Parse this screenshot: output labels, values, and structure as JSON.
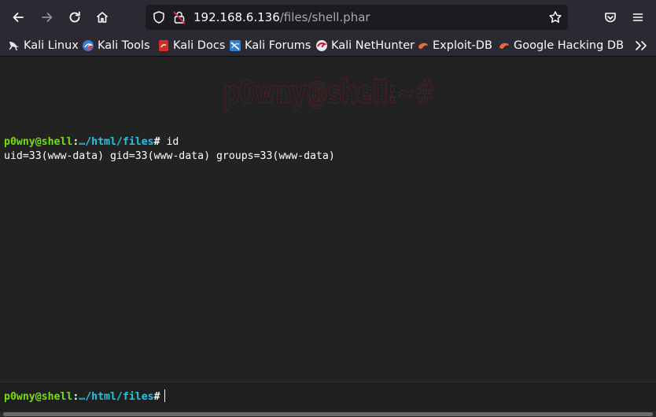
{
  "browser": {
    "url_host": "192.168.6.136",
    "url_path": "/files/shell.phar"
  },
  "bookmarks": [
    {
      "label": "Kali Linux",
      "icon": "kali-dragon-icon"
    },
    {
      "label": "Kali Tools",
      "icon": "kali-tools-icon"
    },
    {
      "label": "Kali Docs",
      "icon": "kali-docs-icon"
    },
    {
      "label": "Kali Forums",
      "icon": "kali-forums-icon"
    },
    {
      "label": "Kali NetHunter",
      "icon": "kali-nethunter-icon"
    },
    {
      "label": "Exploit-DB",
      "icon": "exploit-db-icon"
    },
    {
      "label": "Google Hacking DB",
      "icon": "ghdb-icon"
    }
  ],
  "shell": {
    "banner": "p0wny@shell:~#",
    "banner_color": "#7a1f2b",
    "history": [
      {
        "user": "p0wny@shell",
        "cwd": "…/html/files",
        "command": "id",
        "output": "uid=33(www-data) gid=33(www-data) groups=33(www-data)"
      }
    ],
    "prompt": {
      "user": "p0wny@shell",
      "cwd": "…/html/files",
      "input": ""
    }
  },
  "colors": {
    "prompt_user": "#75df0b",
    "prompt_cwd": "#1bc9e7",
    "terminal_bg": "#222222",
    "toolbar_bg": "#2b2a33"
  }
}
